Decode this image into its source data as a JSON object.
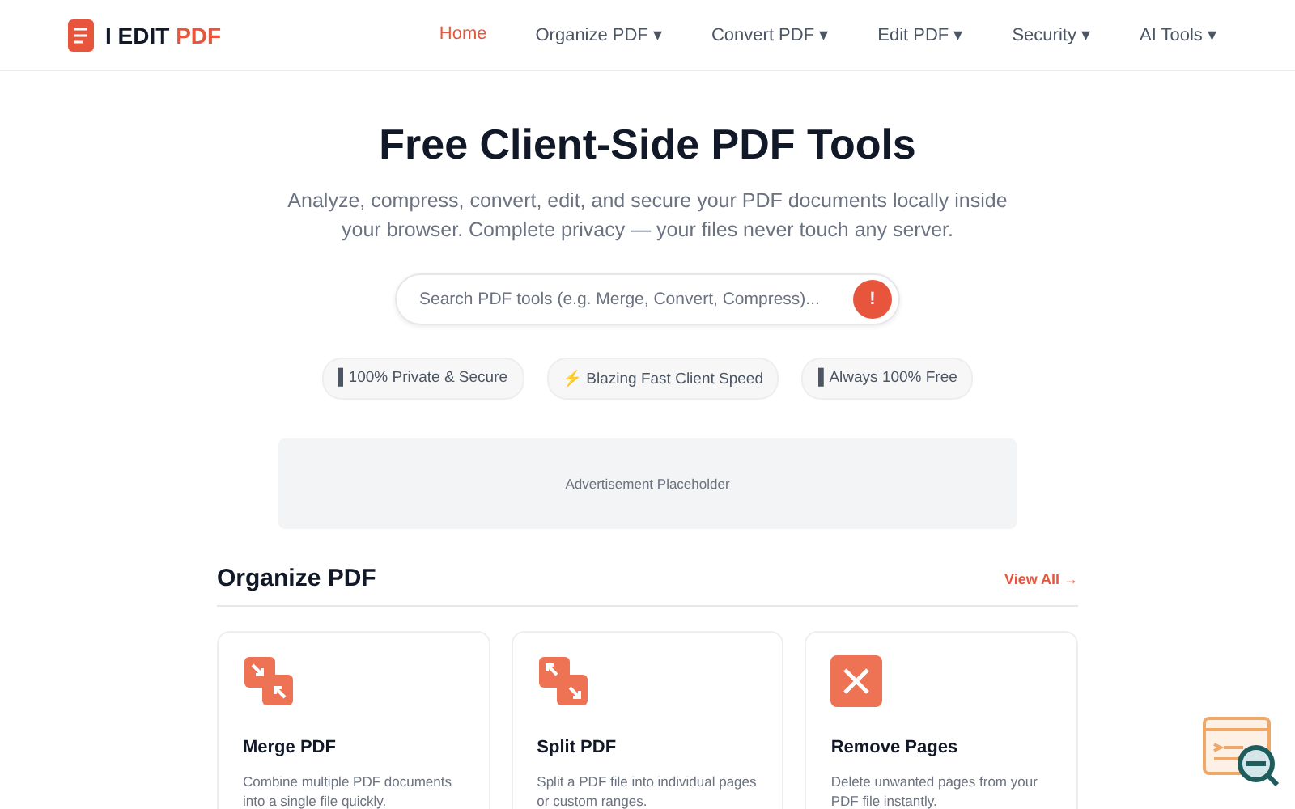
{
  "logo": {
    "text": "I EDIT",
    "accent": "PDF"
  },
  "nav": [
    {
      "label": "Home",
      "selected": true
    },
    {
      "label": "Organize PDF ▾",
      "selected": false
    },
    {
      "label": "Convert PDF ▾",
      "selected": false
    },
    {
      "label": "Edit PDF ▾",
      "selected": false
    },
    {
      "label": "Security ▾",
      "selected": false
    },
    {
      "label": "AI Tools ▾",
      "selected": false
    }
  ],
  "hero": {
    "title": "Free Client-Side PDF Tools",
    "subtitle": "Analyze, compress, convert, edit, and secure your PDF documents locally inside your browser. Complete privacy — your files never touch any server."
  },
  "search": {
    "placeholder": "Search PDF tools (e.g. Merge, Convert, Compress)...",
    "button": "!"
  },
  "badges": [
    "▌100% Private & Secure",
    "⚡ Blazing Fast Client Speed",
    "▌Always 100% Free"
  ],
  "ad": "Advertisement Placeholder",
  "section": {
    "title": "Organize PDF",
    "link": "View All →",
    "cards": [
      {
        "kind": "merge",
        "title": "Merge PDF",
        "description": "Combine multiple PDF documents into a single file quickly."
      },
      {
        "kind": "split",
        "title": "Split PDF",
        "description": "Split a PDF file into individual pages or custom ranges."
      },
      {
        "kind": "remove",
        "title": "Remove Pages",
        "description": "Delete unwanted pages from your PDF file instantly."
      }
    ]
  }
}
